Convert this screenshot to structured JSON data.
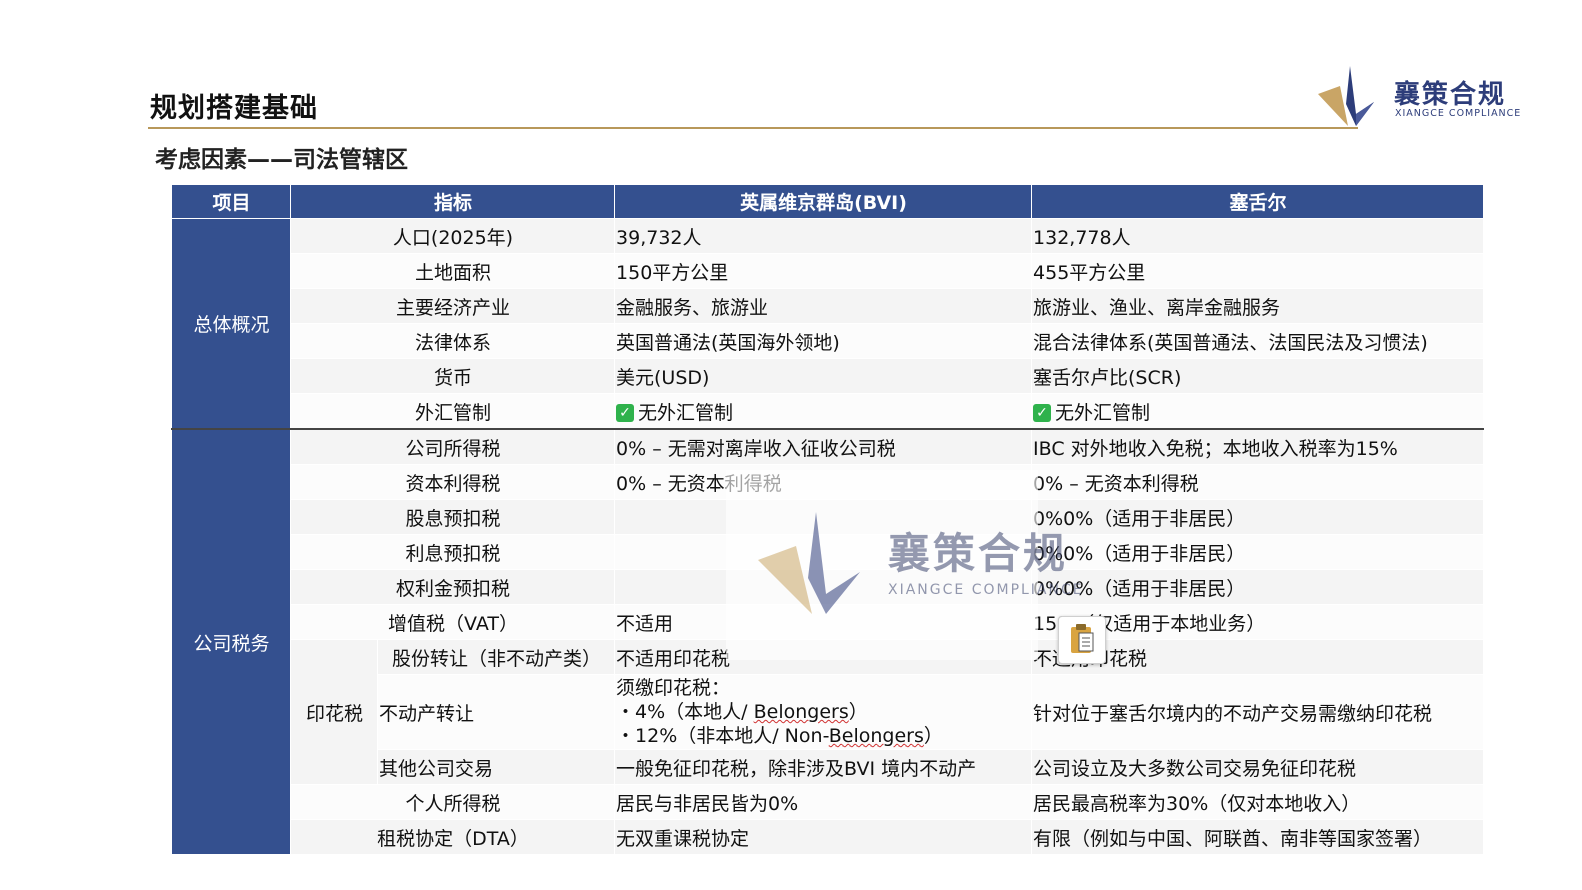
{
  "header": {
    "title": "规划搭建基础",
    "subtitle": "考虑因素——司法管辖区",
    "logo_cn": "襄策合规",
    "logo_en": "XIANGCE COMPLIANCE"
  },
  "table": {
    "columns": [
      "项目",
      "指标",
      "英属维京群岛(BVI)",
      "塞舌尔"
    ],
    "sections": [
      {
        "category": "总体概况",
        "rows": [
          {
            "indicator": "人口(2025年)",
            "bvi": "39,732人",
            "sey": "132,778人"
          },
          {
            "indicator": "土地面积",
            "bvi": "150平方公里",
            "sey": "455平方公里"
          },
          {
            "indicator": "主要经济产业",
            "bvi": "金融服务、旅游业",
            "sey": "旅游业、渔业、离岸金融服务"
          },
          {
            "indicator": "法律体系",
            "bvi": "英国普通法(英国海外领地)",
            "sey": "混合法律体系(英国普通法、法国民法及习惯法)"
          },
          {
            "indicator": "货币",
            "bvi": "美元(USD)",
            "sey": "塞舌尔卢比(SCR)"
          },
          {
            "indicator": "外汇管制",
            "bvi": "无外汇管制",
            "sey": "无外汇管制"
          }
        ]
      },
      {
        "category": "公司税务",
        "rows": [
          {
            "indicator": "公司所得税",
            "bvi": "0% – 无需对离岸收入征收公司税",
            "sey": "IBC 对外地收入免税；本地收入税率为15%"
          },
          {
            "indicator": "资本利得税",
            "bvi": "0% – 无资本利得税",
            "sey": "0% – 无资本利得税"
          },
          {
            "indicator": "股息预扣税",
            "bvi": "",
            "sey": "0%0%（适用于非居民）"
          },
          {
            "indicator": "利息预扣税",
            "bvi": "",
            "sey": "0%0%（适用于非居民）"
          },
          {
            "indicator": "权利金预扣税",
            "bvi": "",
            "sey": "0%0%（适用于非居民）"
          },
          {
            "indicator": "增值税（VAT）",
            "bvi": "不适用",
            "sey": "15%（仅适用于本地业务）"
          }
        ],
        "stamp": {
          "label": "印花税",
          "rows": [
            {
              "indicator": "股份转让（非不动产类）",
              "bvi": "不适用印花税",
              "sey": "不适用印花税"
            },
            {
              "indicator": "不动产转让",
              "bvi_head": "须缴印花税：",
              "bvi_l1a": "・4%（本地人/ ",
              "bvi_l1b": "Belongers",
              "bvi_l1c": "）",
              "bvi_l2a": "・12%（非本地人/ Non-",
              "bvi_l2b": "Belongers",
              "bvi_l2c": "）",
              "sey": "针对位于塞舌尔境内的不动产交易需缴纳印花税"
            },
            {
              "indicator": "其他公司交易",
              "bvi": "一般免征印花税，除非涉及BVI 境内不动产",
              "sey": "公司设立及大多数公司交易免征印花税"
            }
          ]
        },
        "tail_rows": [
          {
            "indicator": "个人所得税",
            "bvi": "居民与非居民皆为0%",
            "sey": "居民最高税率为30%（仅对本地收入）"
          },
          {
            "indicator": "租税协定（DTA）",
            "bvi": "无双重课税协定",
            "sey": "有限（例如与中国、阿联酋、南非等国家签署）"
          }
        ]
      }
    ]
  },
  "watermark": {
    "cn": "襄策合规",
    "en": "XIANGCE COMPLIANCE"
  },
  "icons": {
    "check": "check-mark-icon",
    "clipboard": "clipboard-icon"
  },
  "colors": {
    "header_blue": "#34508f",
    "gold": "#b8985a",
    "check_green": "#2fb24c"
  }
}
